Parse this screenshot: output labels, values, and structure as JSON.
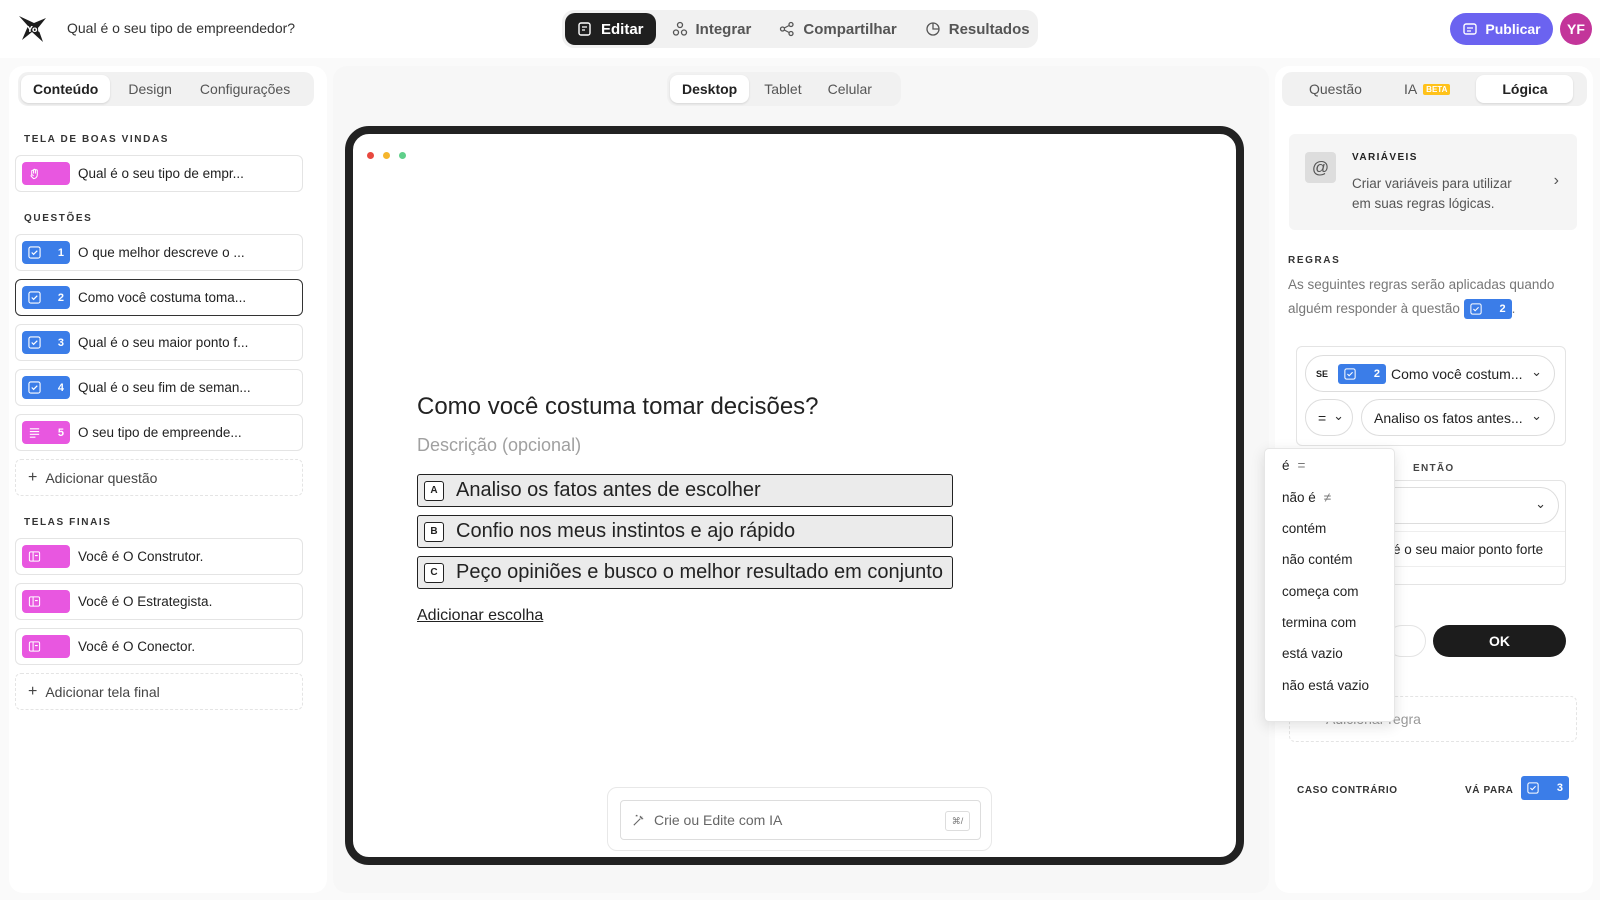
{
  "header": {
    "form_title": "Qual é o seu tipo de empreendedor?",
    "tabs": [
      {
        "label": "Editar",
        "icon": "edit-icon",
        "active": true
      },
      {
        "label": "Integrar",
        "icon": "integrations-icon",
        "active": false
      },
      {
        "label": "Compartilhar",
        "icon": "share-icon",
        "active": false
      },
      {
        "label": "Resultados",
        "icon": "results-icon",
        "active": false
      }
    ],
    "publish_label": "Publicar",
    "avatar_initials": "YF"
  },
  "left": {
    "tabs": [
      "Conteúdo",
      "Design",
      "Configurações"
    ],
    "welcome_label": "TELA DE BOAS VINDAS",
    "welcome_item": "Qual é o seu tipo de empr...",
    "questions_label": "QUESTÕES",
    "questions": [
      {
        "num": "1",
        "text": "O que melhor descreve o ...",
        "type": "checkbox"
      },
      {
        "num": "2",
        "text": "Como você costuma toma...",
        "type": "checkbox"
      },
      {
        "num": "3",
        "text": "Qual é o seu maior ponto f...",
        "type": "checkbox"
      },
      {
        "num": "4",
        "text": "Qual é o seu fim de seman...",
        "type": "checkbox"
      },
      {
        "num": "5",
        "text": "O seu tipo de empreende...",
        "type": "text"
      }
    ],
    "add_question": "Adicionar questão",
    "endings_label": "TELAS FINAIS",
    "endings": [
      "Você é O Construtor.",
      "Você é O Estrategista.",
      "Você é O Conector."
    ],
    "add_ending": "Adicionar tela final"
  },
  "center": {
    "device_tabs": [
      "Desktop",
      "Tablet",
      "Celular"
    ],
    "question": "Como você costuma tomar decisões?",
    "description": "Descrição (opcional)",
    "choices": [
      {
        "key": "A",
        "text": "Analiso os fatos antes de escolher"
      },
      {
        "key": "B",
        "text": "Confio nos meus instintos e ajo rápido"
      },
      {
        "key": "C",
        "text": "Peço opiniões e busco o melhor resultado em conjunto"
      }
    ],
    "add_choice": "Adicionar escolha",
    "ai_placeholder": "Crie ou Edite com IA",
    "ai_shortcut": "⌘/"
  },
  "right": {
    "tabs": [
      "Questão",
      "IA",
      "Lógica"
    ],
    "beta": "BETA",
    "variables_title": "VARIÁVEIS",
    "variables_desc": "Criar variáveis para utilizar em suas regras lógicas.",
    "rules_label": "REGRAS",
    "rules_text": "As seguintes regras serão aplicadas quando alguém responder à questão",
    "rules_badge": "2",
    "if_label": "SE",
    "if_badge": "2",
    "if_question": "Como você costum...",
    "operator": "=",
    "value": "Analiso os fatos antes...",
    "then_label": "ENTÃO",
    "then_text": "é o seu maior ponto forte",
    "ok_label": "OK",
    "add_rule": "Adicionar regra",
    "else_label": "CASO CONTRÁRIO",
    "goto_label": "VÁ PARA",
    "goto_badge": "3"
  },
  "dropdown": [
    {
      "label": "é",
      "sym": "="
    },
    {
      "label": "não é",
      "sym": "≠"
    },
    {
      "label": "contém",
      "sym": ""
    },
    {
      "label": "não contém",
      "sym": ""
    },
    {
      "label": "começa com",
      "sym": ""
    },
    {
      "label": "termina com",
      "sym": ""
    },
    {
      "label": "está vazio",
      "sym": ""
    },
    {
      "label": "não está vazio",
      "sym": ""
    }
  ],
  "colors": {
    "accent": "#6b63f0",
    "badge_blue": "#3b7de8",
    "badge_pink": "#e857e0",
    "avatar": "#c3359a",
    "dot_red": "#e8483f",
    "dot_yellow": "#f5b52c",
    "dot_green": "#5fcf8a"
  }
}
